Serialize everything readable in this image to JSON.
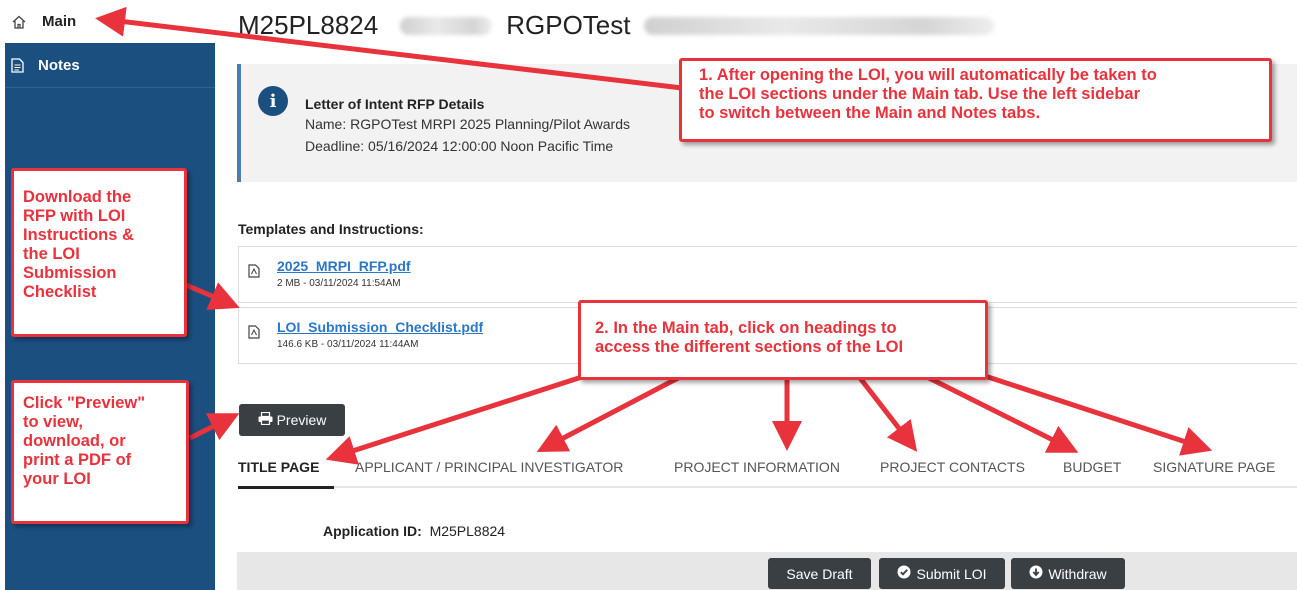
{
  "sidebar": {
    "main_label": "Main",
    "notes_label": "Notes"
  },
  "header": {
    "code": "M25PL8824",
    "name": "RGPOTest"
  },
  "info": {
    "title": "Letter of Intent RFP Details",
    "name_line": "Name: RGPOTest MRPI 2025 Planning/Pilot Awards",
    "deadline_line": "Deadline: 05/16/2024 12:00:00 Noon Pacific Time"
  },
  "templates": {
    "heading": "Templates and Instructions:",
    "files": [
      {
        "name": "2025_MRPI_RFP.pdf",
        "meta": "2 MB - 03/11/2024 11:54AM"
      },
      {
        "name": "LOI_Submission_Checklist.pdf",
        "meta": "146.6 KB - 03/11/2024 11:44AM"
      }
    ]
  },
  "preview_label": "Preview",
  "tabs": [
    "TITLE PAGE",
    "APPLICANT / PRINCIPAL INVESTIGATOR",
    "PROJECT INFORMATION",
    "PROJECT CONTACTS",
    "BUDGET",
    "SIGNATURE PAGE"
  ],
  "application": {
    "label": "Application ID:",
    "value": "M25PL8824"
  },
  "actions": {
    "save": "Save Draft",
    "submit": "Submit LOI",
    "withdraw": "Withdraw"
  },
  "annotations": {
    "note1": [
      "1. After opening the LOI, you will automatically be taken to",
      "the LOI sections under the Main tab. Use the left sidebar",
      "to switch between the Main and Notes tabs."
    ],
    "note2": [
      "2. In the Main tab, click on headings to",
      "access the different sections of the LOI"
    ],
    "download": [
      "Download the",
      "RFP with LOI",
      "Instructions &",
      "the LOI",
      "Submission",
      "Checklist"
    ],
    "preview": [
      "Click \"Preview\"",
      "to view,",
      "download, or",
      "print a PDF of",
      "your LOI"
    ]
  },
  "colors": {
    "sidebar": "#1b4f80",
    "annotation": "#e8323c",
    "button": "#3a3f44",
    "link": "#2a77c9"
  }
}
